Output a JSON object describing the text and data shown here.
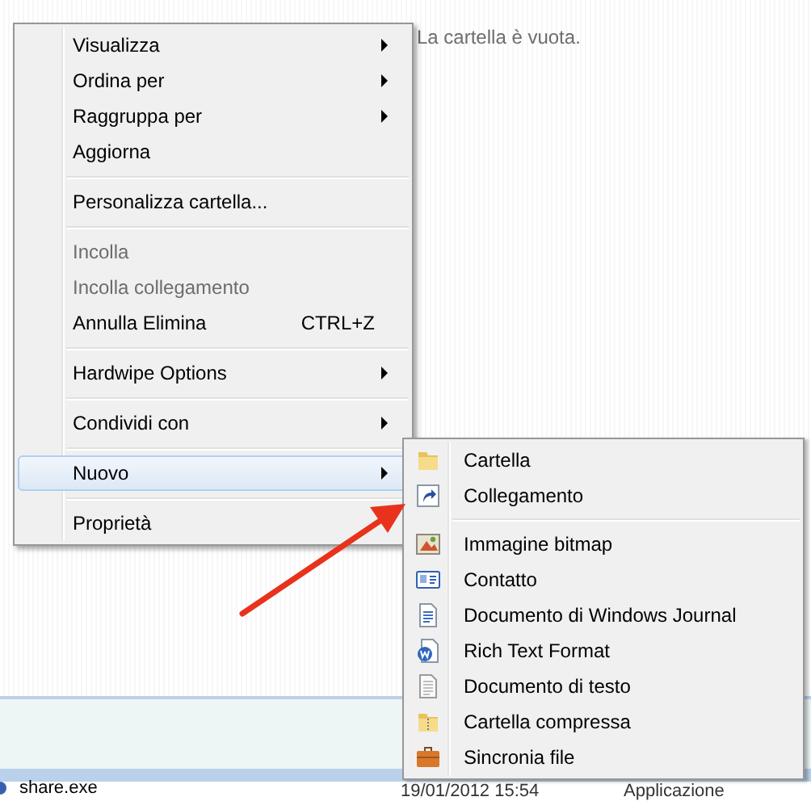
{
  "empty_message": "La cartella è vuota.",
  "context_menu": {
    "items": [
      {
        "kind": "item",
        "label": "Visualizza",
        "submenu": true,
        "disabled": false,
        "selected": false
      },
      {
        "kind": "item",
        "label": "Ordina per",
        "submenu": true,
        "disabled": false,
        "selected": false
      },
      {
        "kind": "item",
        "label": "Raggruppa per",
        "submenu": true,
        "disabled": false,
        "selected": false
      },
      {
        "kind": "item",
        "label": "Aggiorna",
        "submenu": false,
        "disabled": false,
        "selected": false
      },
      {
        "kind": "separator"
      },
      {
        "kind": "item",
        "label": "Personalizza cartella...",
        "submenu": false,
        "disabled": false,
        "selected": false
      },
      {
        "kind": "separator"
      },
      {
        "kind": "item",
        "label": "Incolla",
        "submenu": false,
        "disabled": true,
        "selected": false
      },
      {
        "kind": "item",
        "label": "Incolla collegamento",
        "submenu": false,
        "disabled": true,
        "selected": false
      },
      {
        "kind": "item",
        "label": "Annulla Elimina",
        "shortcut": "CTRL+Z",
        "submenu": false,
        "disabled": false,
        "selected": false
      },
      {
        "kind": "separator"
      },
      {
        "kind": "item",
        "label": "Hardwipe Options",
        "submenu": true,
        "disabled": false,
        "selected": false
      },
      {
        "kind": "separator"
      },
      {
        "kind": "item",
        "label": "Condividi con",
        "submenu": true,
        "disabled": false,
        "selected": false
      },
      {
        "kind": "separator"
      },
      {
        "kind": "item",
        "label": "Nuovo",
        "submenu": true,
        "disabled": false,
        "selected": true
      },
      {
        "kind": "separator"
      },
      {
        "kind": "item",
        "label": "Proprietà",
        "submenu": false,
        "disabled": false,
        "selected": false
      }
    ]
  },
  "submenu": {
    "items": [
      {
        "kind": "item",
        "label": "Cartella"
      },
      {
        "kind": "item",
        "label": "Collegamento"
      },
      {
        "kind": "separator"
      },
      {
        "kind": "item",
        "label": "Immagine bitmap"
      },
      {
        "kind": "item",
        "label": "Contatto"
      },
      {
        "kind": "item",
        "label": "Documento di Windows Journal"
      },
      {
        "kind": "item",
        "label": "Rich Text Format"
      },
      {
        "kind": "item",
        "label": "Documento di testo"
      },
      {
        "kind": "item",
        "label": "Cartella compressa"
      },
      {
        "kind": "item",
        "label": "Sincronia file"
      }
    ]
  },
  "file_row": {
    "name": "share.exe",
    "date": "19/01/2012 15:54",
    "type": "Applicazione"
  }
}
